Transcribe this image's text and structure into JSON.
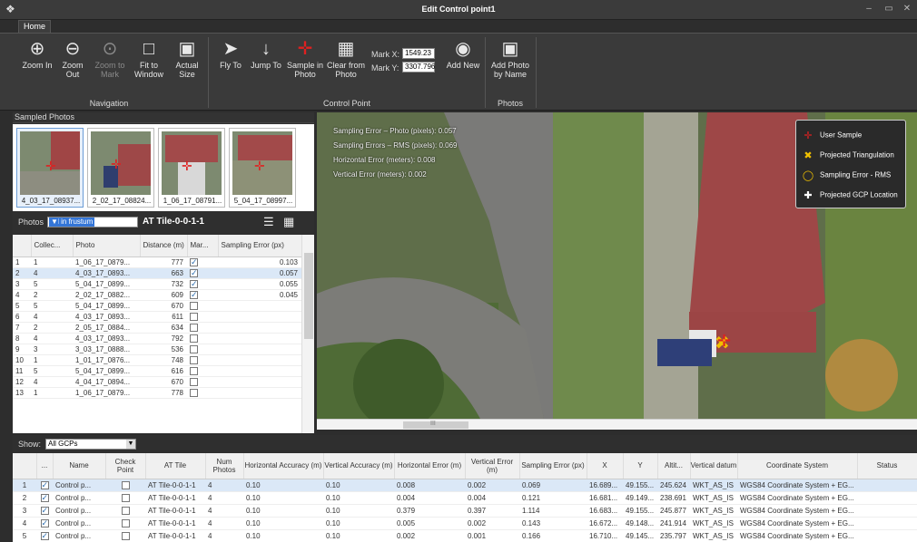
{
  "window": {
    "title": "Edit Control point1"
  },
  "tabs": [
    {
      "label": "Home"
    }
  ],
  "ribbon": {
    "buttons": [
      {
        "label": "Zoom In",
        "icon": "zoom-in-icon"
      },
      {
        "label": "Zoom Out",
        "icon": "zoom-out-icon"
      },
      {
        "label": "Zoom to Mark",
        "icon": "zoom-to-mark-icon"
      },
      {
        "label": "Fit to Window",
        "icon": "fit-window-icon"
      },
      {
        "label": "Actual Size",
        "icon": "actual-size-icon"
      },
      {
        "label": "Fly To",
        "icon": "fly-to-icon"
      },
      {
        "label": "Jump To",
        "icon": "jump-to-icon"
      },
      {
        "label": "Sample in Photo",
        "icon": "sample-icon"
      },
      {
        "label": "Clear from Photo",
        "icon": "trash-icon"
      },
      {
        "label": "Add New",
        "icon": "map-pin-icon"
      },
      {
        "label": "Add Photo by Name",
        "icon": "photo-search-icon"
      }
    ],
    "groups": {
      "navigation": "Navigation",
      "control_point": "Control Point",
      "photos": "Photos"
    },
    "mark_x_label": "Mark X:",
    "mark_x_value": "1549.23",
    "mark_y_label": "Mark Y:",
    "mark_y_value": "3307.796"
  },
  "sampled_photos": {
    "header": "Sampled Photos",
    "thumbnails": [
      "4_03_17_08937...",
      "2_02_17_08824...",
      "1_06_17_08791...",
      "5_04_17_08997..."
    ]
  },
  "photos_filter": {
    "label": "Photos",
    "selected": "All in frustum",
    "tile": "AT Tile-0-0-1-1"
  },
  "photo_table": {
    "columns": [
      "",
      "Collec...",
      "Photo",
      "Distance (m)",
      "Mar...",
      "Sampling Error (px)"
    ],
    "rows": [
      {
        "n": "1",
        "col": "1",
        "photo": "1_06_17_0879...",
        "dist": "777",
        "marked": true,
        "err": "0.103"
      },
      {
        "n": "2",
        "col": "4",
        "photo": "4_03_17_0893...",
        "dist": "663",
        "marked": true,
        "err": "0.057"
      },
      {
        "n": "3",
        "col": "5",
        "photo": "5_04_17_0899...",
        "dist": "732",
        "marked": true,
        "err": "0.055"
      },
      {
        "n": "4",
        "col": "2",
        "photo": "2_02_17_0882...",
        "dist": "609",
        "marked": true,
        "err": "0.045"
      },
      {
        "n": "5",
        "col": "5",
        "photo": "5_04_17_0899...",
        "dist": "670",
        "marked": false,
        "err": ""
      },
      {
        "n": "6",
        "col": "4",
        "photo": "4_03_17_0893...",
        "dist": "611",
        "marked": false,
        "err": ""
      },
      {
        "n": "7",
        "col": "2",
        "photo": "2_05_17_0884...",
        "dist": "634",
        "marked": false,
        "err": ""
      },
      {
        "n": "8",
        "col": "4",
        "photo": "4_03_17_0893...",
        "dist": "792",
        "marked": false,
        "err": ""
      },
      {
        "n": "9",
        "col": "3",
        "photo": "3_03_17_0888...",
        "dist": "536",
        "marked": false,
        "err": ""
      },
      {
        "n": "10",
        "col": "1",
        "photo": "1_01_17_0876...",
        "dist": "748",
        "marked": false,
        "err": ""
      },
      {
        "n": "11",
        "col": "5",
        "photo": "5_04_17_0899...",
        "dist": "616",
        "marked": false,
        "err": ""
      },
      {
        "n": "12",
        "col": "4",
        "photo": "4_04_17_0894...",
        "dist": "670",
        "marked": false,
        "err": ""
      },
      {
        "n": "13",
        "col": "1",
        "photo": "1_06_17_0879...",
        "dist": "778",
        "marked": false,
        "err": ""
      }
    ]
  },
  "map": {
    "overlay": [
      "Sampling Error – Photo (pixels): 0.057",
      "Sampling Errors – RMS (pixels): 0.069",
      "Horizontal Error (meters): 0.008",
      "Vertical Error (meters): 0.002"
    ],
    "legend": [
      {
        "label": "User Sample",
        "color": "#e02020"
      },
      {
        "label": "Projected Triangulation",
        "color": "#f0c000"
      },
      {
        "label": "Sampling Error - RMS",
        "color": "#f0c000"
      },
      {
        "label": "Projected GCP Location",
        "color": "#ffffff"
      }
    ],
    "scroll_mark": "III"
  },
  "show_filter": {
    "label": "Show:",
    "selected": "All GCPs"
  },
  "gcp_table": {
    "columns": [
      "",
      "...",
      "Name",
      "Check Point",
      "AT Tile",
      "Num Photos",
      "Horizontal Accuracy (m)",
      "Vertical Accuracy (m)",
      "Horizontal Error (m)",
      "Vertical Error (m)",
      "Sampling Error (px)",
      "X",
      "Y",
      "Altit...",
      "Vertical datum",
      "Coordinate System",
      "Status"
    ],
    "rows": [
      {
        "n": "1",
        "name": "Control p...",
        "tile": "AT Tile-0-0-1-1",
        "num": "4",
        "ha": "0.10",
        "va": "0.10",
        "he": "0.008",
        "ve": "0.002",
        "se": "0.069",
        "x": "16.689...",
        "y": "49.155...",
        "alt": "245.624",
        "datum": "WKT_AS_IS",
        "cs": "WGS84 Coordinate System + EG...",
        "status": ""
      },
      {
        "n": "2",
        "name": "Control p...",
        "tile": "AT Tile-0-0-1-1",
        "num": "4",
        "ha": "0.10",
        "va": "0.10",
        "he": "0.004",
        "ve": "0.004",
        "se": "0.121",
        "x": "16.681...",
        "y": "49.149...",
        "alt": "238.691",
        "datum": "WKT_AS_IS",
        "cs": "WGS84 Coordinate System + EG...",
        "status": ""
      },
      {
        "n": "3",
        "name": "Control p...",
        "tile": "AT Tile-0-0-1-1",
        "num": "4",
        "ha": "0.10",
        "va": "0.10",
        "he": "0.379",
        "ve": "0.397",
        "se": "1.114",
        "x": "16.683...",
        "y": "49.155...",
        "alt": "245.877",
        "datum": "WKT_AS_IS",
        "cs": "WGS84 Coordinate System + EG...",
        "status": ""
      },
      {
        "n": "4",
        "name": "Control p...",
        "tile": "AT Tile-0-0-1-1",
        "num": "4",
        "ha": "0.10",
        "va": "0.10",
        "he": "0.005",
        "ve": "0.002",
        "se": "0.143",
        "x": "16.672...",
        "y": "49.148...",
        "alt": "241.914",
        "datum": "WKT_AS_IS",
        "cs": "WGS84 Coordinate System + EG...",
        "status": ""
      },
      {
        "n": "5",
        "name": "Control p...",
        "tile": "AT Tile-0-0-1-1",
        "num": "4",
        "ha": "0.10",
        "va": "0.10",
        "he": "0.002",
        "ve": "0.001",
        "se": "0.166",
        "x": "16.710...",
        "y": "49.145...",
        "alt": "235.797",
        "datum": "WKT_AS_IS",
        "cs": "WGS84 Coordinate System + EG...",
        "status": ""
      }
    ]
  }
}
